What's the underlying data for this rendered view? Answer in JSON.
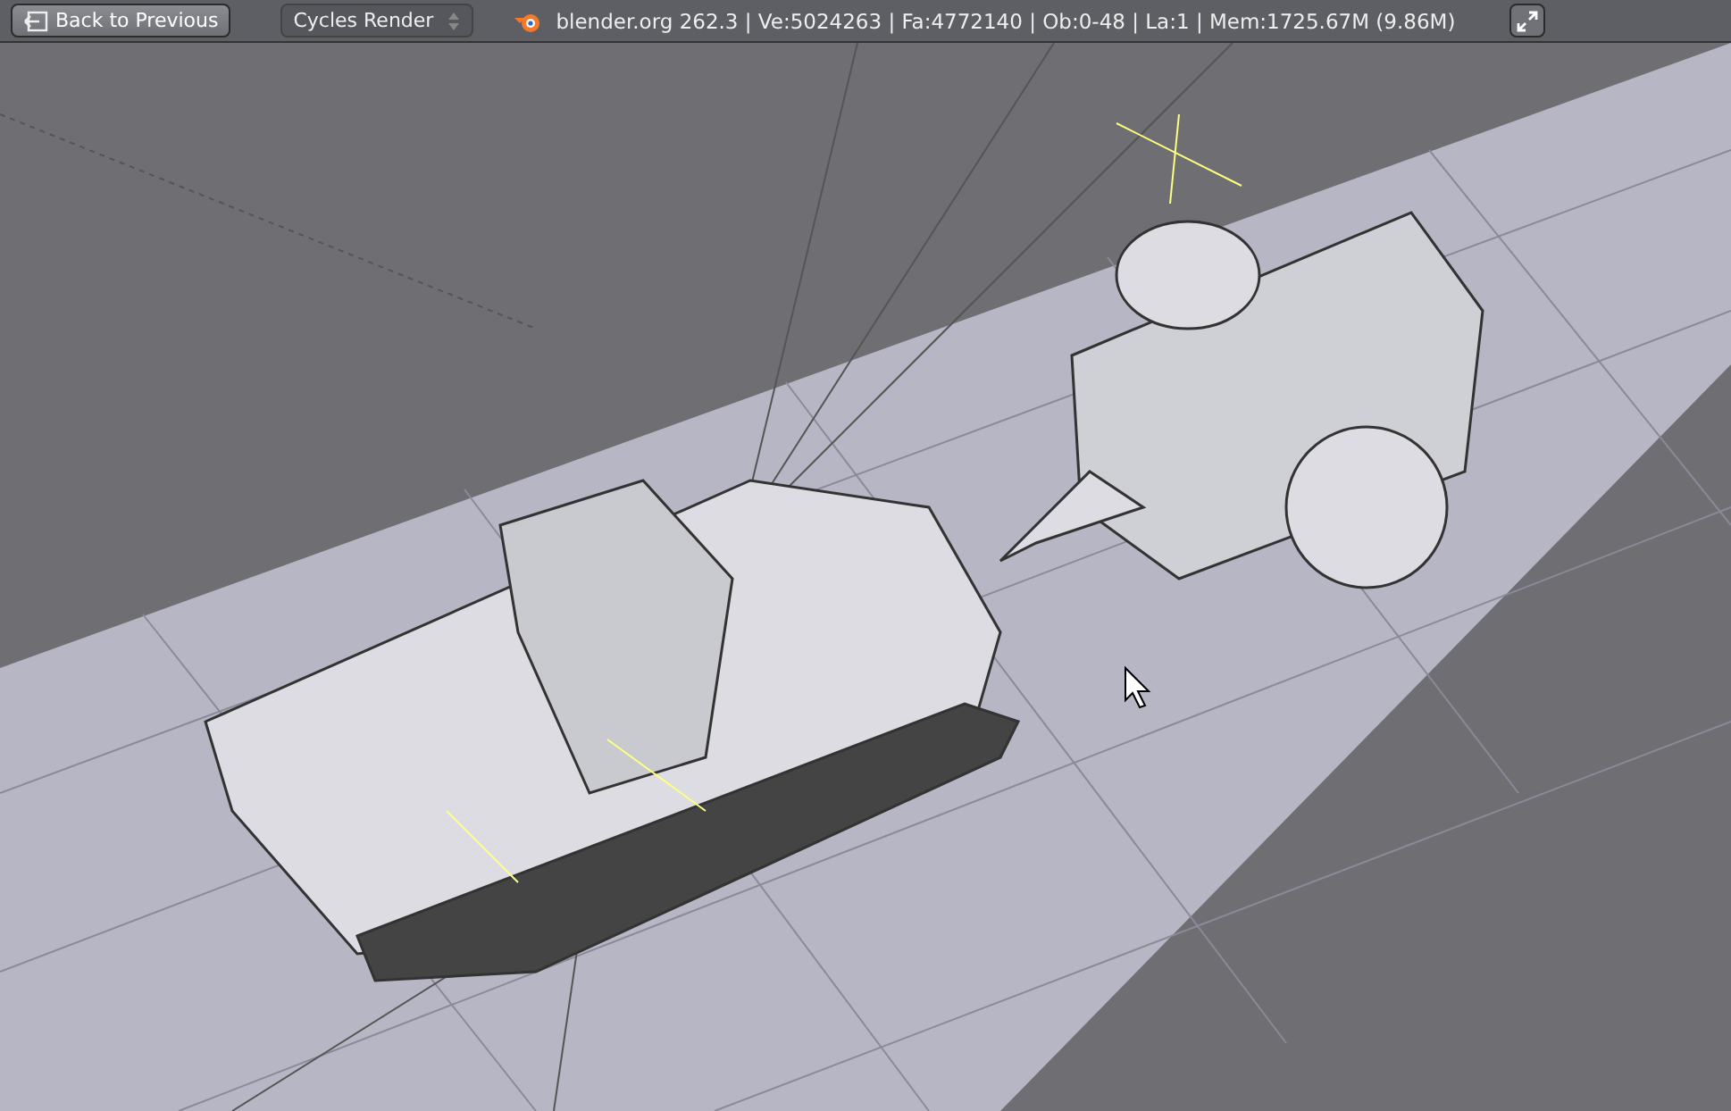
{
  "header": {
    "back_button": "Back to Previous",
    "render_engine": "Cycles Render",
    "stats": "blender.org 262.3 | Ve:5024263 | Fa:4772140 | Ob:0-48 | La:1 | Mem:1725.67M (9.86M)"
  }
}
